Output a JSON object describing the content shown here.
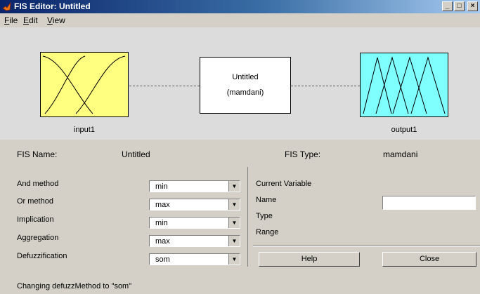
{
  "window": {
    "title": "FIS Editor: Untitled",
    "controls": [
      "_",
      "□",
      "×"
    ]
  },
  "menu": [
    "File",
    "Edit",
    "View"
  ],
  "diagram": {
    "input_label": "input1",
    "output_label": "output1",
    "system_name": "Untitled",
    "system_type": "(mamdani)",
    "input_color": "#ffff80",
    "output_color": "#80ffff"
  },
  "info": {
    "fis_name_label": "FIS Name:",
    "fis_name_value": "Untitled",
    "fis_type_label": "FIS Type:",
    "fis_type_value": "mamdani"
  },
  "methods": [
    {
      "label": "And method",
      "value": "min"
    },
    {
      "label": "Or method",
      "value": "max"
    },
    {
      "label": "Implication",
      "value": "min"
    },
    {
      "label": "Aggregation",
      "value": "max"
    },
    {
      "label": "Defuzzification",
      "value": "som"
    }
  ],
  "current_variable": {
    "heading": "Current Variable",
    "name_label": "Name",
    "type_label": "Type",
    "range_label": "Range",
    "name_value": ""
  },
  "buttons": {
    "help": "Help",
    "close": "Close"
  },
  "status": "Changing defuzzMethod to \"som\""
}
